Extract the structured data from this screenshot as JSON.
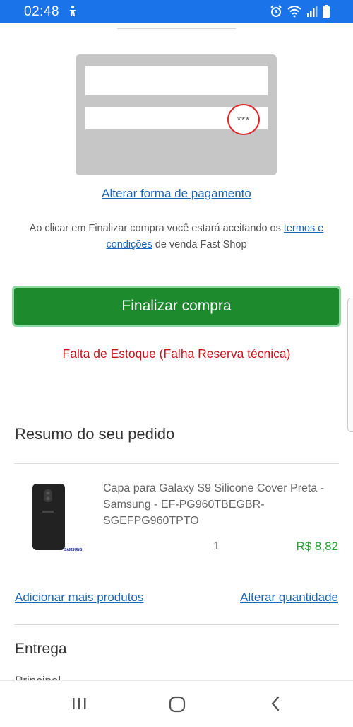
{
  "status_bar": {
    "time": "02:48",
    "left_icon": "accessibility-icon",
    "right_icons": [
      "alarm-icon",
      "wifi-icon",
      "signal-icon",
      "battery-icon"
    ],
    "color": "#1a73e8"
  },
  "payment": {
    "card_cvv_mask": "***",
    "change_payment_label": "Alterar forma de pagamento"
  },
  "terms": {
    "prefix": "Ao clicar em Finalizar compra você estará aceitando os ",
    "link_label": "termos e condições",
    "suffix": " de venda Fast Shop"
  },
  "checkout": {
    "button_label": "Finalizar compra",
    "button_color": "#1d8a2e",
    "error_message": "Falta de Estoque (Falha Reserva técnica)",
    "error_color": "#c8141d"
  },
  "order_summary": {
    "title": "Resumo do seu pedido",
    "items": [
      {
        "name": "Capa para Galaxy S9 Silicone Cover Preta - Samsung - EF-PG960TBEGBR-SGEFPG960TPTO",
        "quantity": "1",
        "price": "R$ 8,82",
        "image_brand": "SAMSUNG"
      }
    ],
    "add_more_label": "Adicionar mais produtos",
    "change_qty_label": "Alterar quantidade"
  },
  "delivery": {
    "title": "Entrega",
    "subtitle": "Principal"
  },
  "nav_bar": {
    "buttons": [
      "recent-apps-icon",
      "home-icon",
      "back-icon"
    ]
  }
}
